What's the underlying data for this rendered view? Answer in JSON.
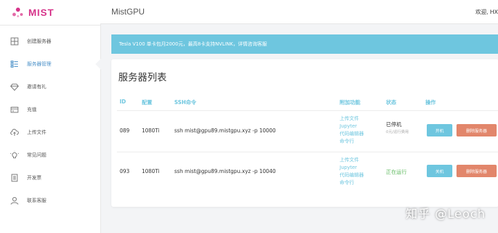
{
  "brand": {
    "logo_text": "MIST",
    "accent": "#d6338a"
  },
  "topbar": {
    "title": "MistGPU",
    "greeting": "欢迎, HX"
  },
  "sidebar": {
    "items": [
      {
        "label": "创建服务器",
        "icon": "create-server-icon"
      },
      {
        "label": "服务器管理",
        "icon": "server-list-icon",
        "active": true
      },
      {
        "label": "邀请有礼",
        "icon": "diamond-icon"
      },
      {
        "label": "充值",
        "icon": "wallet-icon"
      },
      {
        "label": "上传文件",
        "icon": "cloud-upload-icon"
      },
      {
        "label": "常见问题",
        "icon": "lightbulb-icon"
      },
      {
        "label": "开发票",
        "icon": "invoice-icon"
      },
      {
        "label": "联系客服",
        "icon": "user-icon"
      }
    ]
  },
  "alert": {
    "text": "Tesla V100 单卡包月2000元，最高8卡支持NVLINK，详情咨询客服"
  },
  "servers": {
    "title": "服务器列表",
    "columns": [
      "ID",
      "配置",
      "SSH命令",
      "附加功能",
      "状态",
      "操作"
    ],
    "rows": [
      {
        "id": "089",
        "config": "1080Ti",
        "ssh": "ssh mist@gpu89.mistgpu.xyz -p 10000",
        "features": [
          "上传文件",
          "Jupyter",
          "代码编辑器",
          "命令行"
        ],
        "status": "已停机",
        "status_sub": "0元/运行费用",
        "power_label": "开机",
        "delete_label": "删除服务器"
      },
      {
        "id": "093",
        "config": "1080Ti",
        "ssh": "ssh mist@gpu89.mistgpu.xyz -p 10040",
        "features": [
          "上传文件",
          "Jupyter",
          "代码编辑器",
          "命令行"
        ],
        "status": "正在运行",
        "power_label": "关机",
        "delete_label": "删除服务器"
      }
    ]
  },
  "watermark": "知乎 @Leoch",
  "colors": {
    "primary": "#6ec6df",
    "danger": "#e2866b",
    "running": "#5cb85c"
  }
}
